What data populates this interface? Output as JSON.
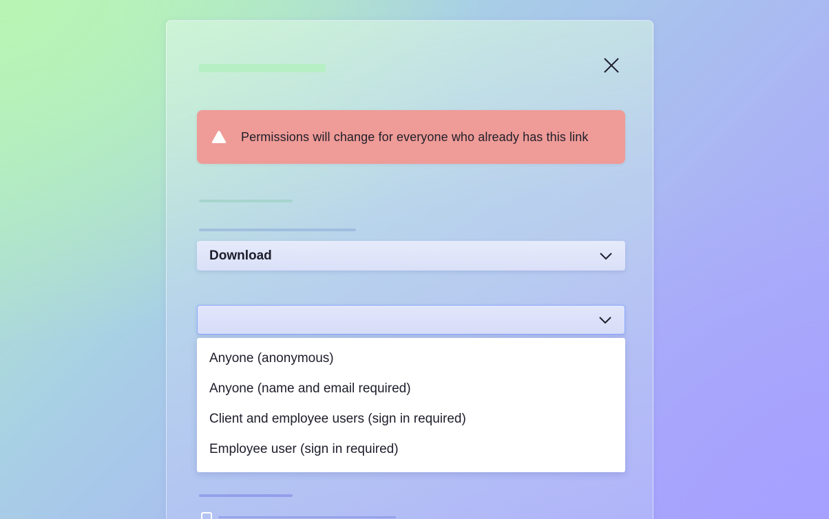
{
  "alert": {
    "message": "Permissions will change for everyone who already has this link",
    "icon": "warning-triangle-icon",
    "color": "#ef9b97"
  },
  "close": {
    "icon": "close-icon"
  },
  "access_select": {
    "value": "Download"
  },
  "audience_select": {
    "value": "",
    "options": [
      "Anyone (anonymous)",
      "Anyone (name and email required)",
      "Client and employee users (sign in required)",
      "Employee user (sign in required)"
    ]
  },
  "colors": {
    "focus_border": "#8aa8ff",
    "text": "#1d1d2b"
  }
}
